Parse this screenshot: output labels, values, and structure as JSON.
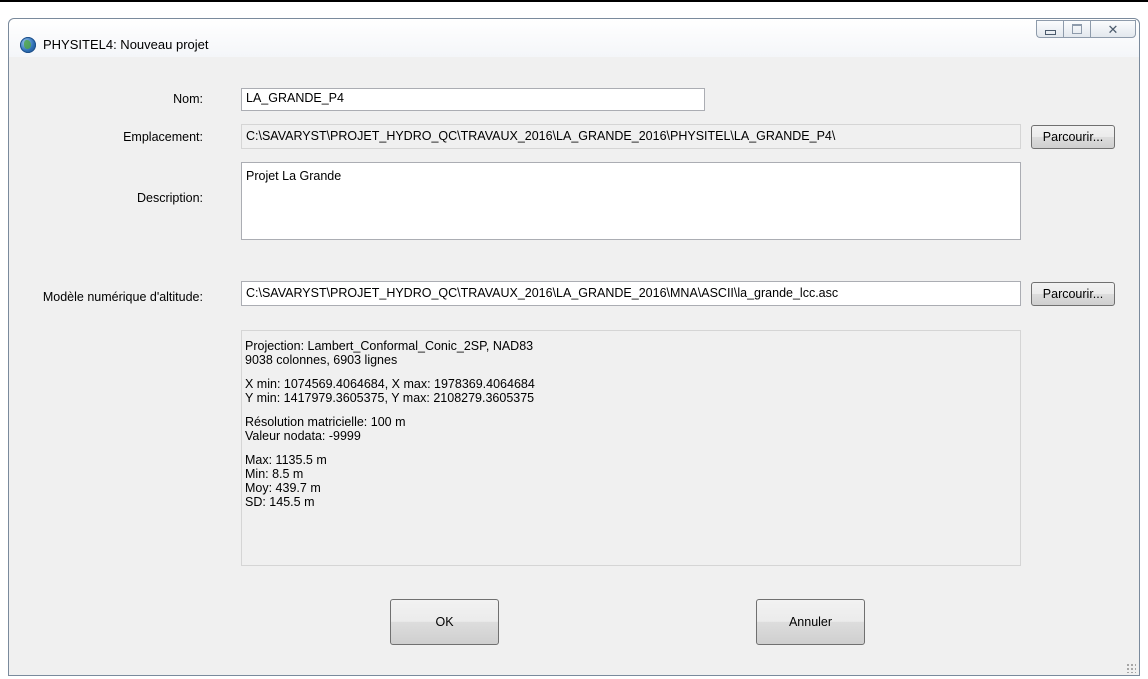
{
  "window": {
    "title": "PHYSITEL4: Nouveau projet"
  },
  "form": {
    "nom_label": "Nom:",
    "nom_value": "LA_GRANDE_P4",
    "emplacement_label": "Emplacement:",
    "emplacement_value": "C:\\SAVARYST\\PROJET_HYDRO_QC\\TRAVAUX_2016\\LA_GRANDE_2016\\PHYSITEL\\LA_GRANDE_P4\\",
    "description_label": "Description:",
    "description_value": "Projet La Grande",
    "mna_label": "Modèle numérique d'altitude:",
    "mna_value": "C:\\SAVARYST\\PROJET_HYDRO_QC\\TRAVAUX_2016\\LA_GRANDE_2016\\MNA\\ASCII\\la_grande_lcc.asc",
    "browse_label": "Parcourir..."
  },
  "info": {
    "projection": "Projection: Lambert_Conformal_Conic_2SP, NAD83",
    "dimensions": "9038 colonnes, 6903 lignes",
    "x_range": "X min: 1074569.4064684, X max: 1978369.4064684",
    "y_range": "Y min: 1417979.3605375, Y max: 2108279.3605375",
    "resolution": "Résolution matricielle: 100 m",
    "nodata": "Valeur nodata: -9999",
    "max": "Max: 1135.5 m",
    "min": "Min: 8.5 m",
    "mean": "Moy: 439.7 m",
    "sd": "SD: 145.5 m"
  },
  "buttons": {
    "ok": "OK",
    "cancel": "Annuler"
  }
}
